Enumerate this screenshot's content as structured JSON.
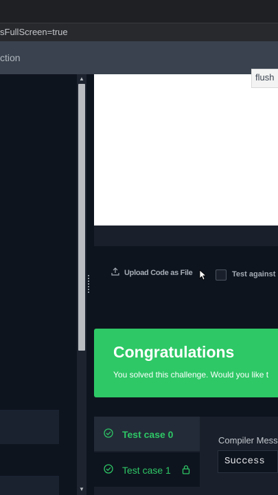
{
  "browser": {
    "url_fragment": "sFullScreen=true"
  },
  "header": {
    "title_fragment": "ction"
  },
  "editor": {
    "flush_label": "flush"
  },
  "toolbar": {
    "upload_label": "Upload Code as File",
    "test_against_label": "Test against"
  },
  "result_banner": {
    "title": "Congratulations",
    "subtitle": "You solved this challenge. Would you like t"
  },
  "test_cases": [
    {
      "label": "Test case 0",
      "status": "passed",
      "locked": false
    },
    {
      "label": "Test case 1",
      "status": "passed",
      "locked": true
    }
  ],
  "compiler": {
    "label": "Compiler Mess",
    "value": "Success"
  },
  "colors": {
    "success": "#2ec866",
    "background": "#0e141e",
    "panel": "#1a202b"
  }
}
